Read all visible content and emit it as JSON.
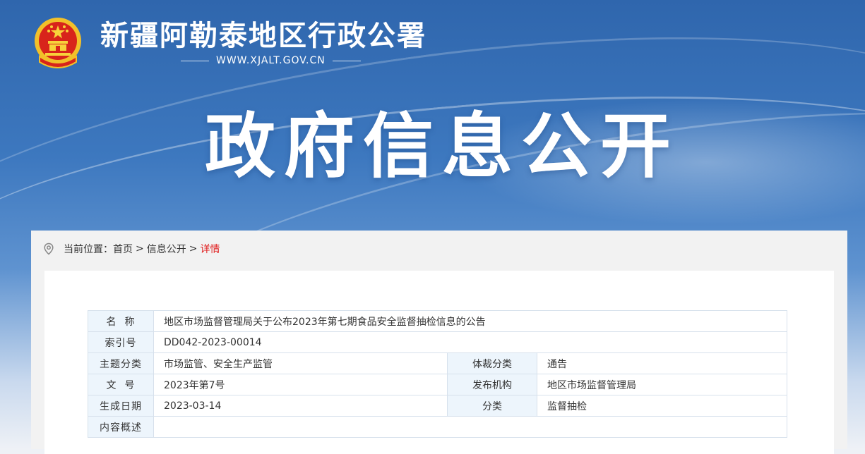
{
  "header": {
    "site_title": "新疆阿勒泰地区行政公署",
    "site_domain": "WWW.XJALT.GOV.CN",
    "banner_title": "政府信息公开"
  },
  "breadcrumb": {
    "prefix": "当前位置：",
    "items": [
      "首页",
      "信息公开"
    ],
    "separator": ">",
    "current": "详情"
  },
  "info_table": {
    "name_label": "名  称",
    "name_value": "地区市场监督管理局关于公布2023年第七期食品安全监督抽检信息的公告",
    "index_label": "索引号",
    "index_value": "DD042-2023-00014",
    "topic_label": "主题分类",
    "topic_value": "市场监管、安全生产监管",
    "genre_label": "体裁分类",
    "genre_value": "通告",
    "doc_no_label": "文  号",
    "doc_no_value": "2023年第7号",
    "publisher_label": "发布机构",
    "publisher_value": "地区市场监督管理局",
    "date_label": "生成日期",
    "date_value": "2023-03-14",
    "category_label": "分类",
    "category_value": "监督抽检",
    "summary_label": "内容概述",
    "summary_value": ""
  },
  "colors": {
    "banner_blue": "#2f66ad",
    "breadcrumb_current": "#e02020",
    "label_cell_bg": "#edf5fc",
    "table_border": "#d7e1ec"
  }
}
